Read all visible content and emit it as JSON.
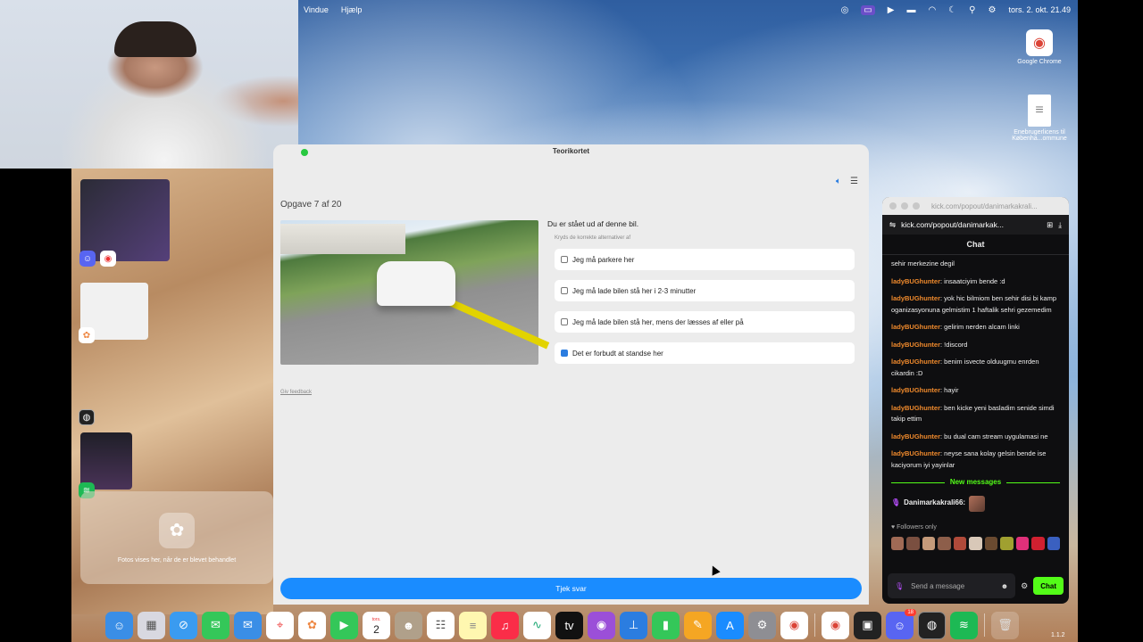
{
  "menubar": {
    "items": [
      "Vindue",
      "Hjælp"
    ],
    "clock": "tors. 2. okt.  21.49"
  },
  "window": {
    "title": "Teorikortet",
    "task_title": "Opgave 7 af 20",
    "question": "Du er stået ud af denne bil.",
    "instruction": "Kryds de korrekte alternativer af",
    "options": [
      {
        "label": "Jeg må parkere her",
        "checked": false
      },
      {
        "label": "Jeg må lade bilen stå her i 2-3 minutter",
        "checked": false
      },
      {
        "label": "Jeg må lade bilen stå her, mens der læsses af eller på",
        "checked": false
      },
      {
        "label": "Det er forbudt at standse her",
        "checked": true
      }
    ],
    "feedback_link": "Giv feedback",
    "submit_label": "Tjek svar"
  },
  "desktop_icons": [
    {
      "label": "Google Chrome",
      "icon": "chrome-icon"
    },
    {
      "label": "Enebrugerlicens til Københa...ommune",
      "icon": "document-icon"
    }
  ],
  "stage_manager": {
    "photos_caption": "Fotos vises her, når de er blevet behandlet"
  },
  "chat": {
    "window_title": "kick.com/popout/danimarkakrali...",
    "url": "kick.com/popout/danimarkak...",
    "header": "Chat",
    "messages": [
      {
        "user": "",
        "text": "sehir merkezine degil"
      },
      {
        "user": "ladyBUGhunter",
        "text": ": insaatciyim bende :d"
      },
      {
        "user": "ladyBUGhunter",
        "text": ": yok hic bilmiom ben sehir disi bi kamp oganizasyonuna gelmistim 1 haftalik sehri gezemedim"
      },
      {
        "user": "ladyBUGhunter",
        "text": ": gelirim nerden alcam linki"
      },
      {
        "user": "ladyBUGhunter",
        "text": ": !discord"
      },
      {
        "user": "ladyBUGhunter",
        "text": ": benim isvecte olduugmu enrden cikardin :D"
      },
      {
        "user": "ladyBUGhunter",
        "text": ": hayir"
      },
      {
        "user": "ladyBUGhunter",
        "text": ": ben kicke yeni basladim senide simdi takip ettim"
      },
      {
        "user": "ladyBUGhunter",
        "text": ": bu dual cam stream uygulamasi ne"
      },
      {
        "user": "ladyBUGhunter",
        "text": ": neyse sana kolay gelsin bende ise kaciyorum iyi yayinlar"
      }
    ],
    "new_messages_label": "New messages",
    "streamer_name": "Danimarkakrali66:",
    "followers_only": "Followers only",
    "input_placeholder": "Send a message",
    "send_label": "Chat"
  },
  "dock": {
    "calendar_day": "2",
    "calendar_month": "tors.",
    "discord_badge": "18",
    "version": "1.1.2"
  },
  "colors": {
    "accent_blue": "#1a8cff",
    "kick_green": "#53fc18",
    "chat_user": "#f08a2c"
  }
}
